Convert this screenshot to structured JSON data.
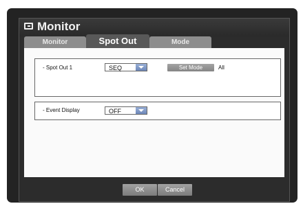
{
  "window": {
    "title": "Monitor",
    "title_icon": "monitor-icon"
  },
  "tabs": [
    {
      "label": "Monitor",
      "active": false
    },
    {
      "label": "Spot Out",
      "active": true
    },
    {
      "label": "Mode",
      "active": false
    }
  ],
  "spot_out": {
    "label": "- Spot Out 1",
    "selected": "SEQ",
    "set_mode_label": "Set Mode",
    "value_text": "All"
  },
  "event_display": {
    "label": "- Event Display",
    "selected": "OFF"
  },
  "footer": {
    "ok_label": "OK",
    "cancel_label": "Cancel"
  },
  "colors": {
    "accent_dropdown": "#7f97c8",
    "tab_active": "#585858",
    "tab_inactive": "#8d8d8d"
  }
}
